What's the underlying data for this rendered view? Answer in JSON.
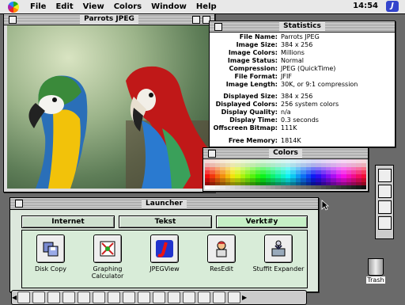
{
  "menubar": {
    "items": [
      "File",
      "Edit",
      "View",
      "Colors",
      "Window",
      "Help"
    ],
    "clock": "14:54",
    "app_icon_glyph": "J"
  },
  "photo_window": {
    "title": "Parrots JPEG"
  },
  "stats_window": {
    "title": "Statistics",
    "rows": [
      {
        "key": "File Name:",
        "value": "Parrots JPEG"
      },
      {
        "key": "Image Size:",
        "value": "384 x 256"
      },
      {
        "key": "Image Colors:",
        "value": "Millions"
      },
      {
        "key": "Image Status:",
        "value": "Normal"
      },
      {
        "key": "Compression:",
        "value": "JPEG (QuickTime)"
      },
      {
        "key": "File Format:",
        "value": "JFIF"
      },
      {
        "key": "Image Length:",
        "value": "30K, or 9:1 compression"
      },
      {
        "key": "Displayed Size:",
        "value": "384 x 256"
      },
      {
        "key": "Displayed Colors:",
        "value": "256 system colors"
      },
      {
        "key": "Display Quality:",
        "value": "n/a"
      },
      {
        "key": "Display Time:",
        "value": "0.3 seconds"
      },
      {
        "key": "Offscreen Bitmap:",
        "value": "111K"
      },
      {
        "key": "Free Memory:",
        "value": "1814K"
      }
    ]
  },
  "colors_window": {
    "title": "Colors"
  },
  "launcher": {
    "title": "Launcher",
    "tabs": [
      "Internet",
      "Tekst",
      "Verkt#y"
    ],
    "active_tab": "Verkt#y",
    "items": [
      {
        "label": "Disk Copy",
        "icon": "disk-copy-icon"
      },
      {
        "label": "Graphing Calculator",
        "icon": "graphing-calculator-icon"
      },
      {
        "label": "JPEGView",
        "icon": "jpegview-icon"
      },
      {
        "label": "ResEdit",
        "icon": "resedit-icon"
      },
      {
        "label": "Stuffit Expander",
        "icon": "stuffit-expander-icon"
      }
    ]
  },
  "trash": {
    "label": "Trash"
  },
  "colors": {
    "accent": "#3344cc",
    "launcher_bg": "#dde8dd",
    "active_tab": "#c6f0c6"
  }
}
